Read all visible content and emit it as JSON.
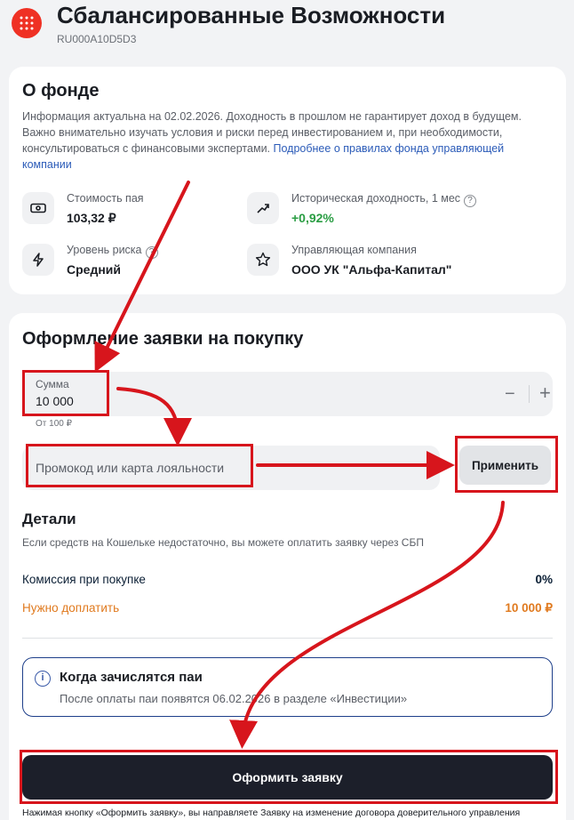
{
  "header": {
    "title": "Сбалансированные Возможности",
    "code": "RU000A10D5D3",
    "brand_color": "#ef3124"
  },
  "about": {
    "heading": "О фонде",
    "disclaimer": "Информация актуальна на 02.02.2026. Доходность в прошлом не гарантирует доход в будущем. Важно внимательно изучать условия и риски перед инвестированием и, при необходимости, консультироваться с финансовыми экспертами.",
    "link_text": "Подробнее о правилах фонда управляющей компании",
    "stats": [
      {
        "icon": "banknote-icon",
        "label": "Стоимость пая",
        "value": "103,32 ₽"
      },
      {
        "icon": "chart-up-icon",
        "label": "Историческая доходность, 1 мес",
        "value": "+0,92%",
        "value_color": "#2a9d43"
      },
      {
        "icon": "lightning-icon",
        "label": "Уровень риска",
        "value": "Средний"
      },
      {
        "icon": "star-icon",
        "label": "Управляющая компания",
        "value": "ООО УК \"Альфа-Капитал\""
      }
    ]
  },
  "order": {
    "heading": "Оформление заявки на покупку",
    "amount": {
      "label": "Сумма",
      "value": "10 000",
      "hint": "От 100 ₽",
      "minus": "−",
      "plus": "+"
    },
    "promo": {
      "placeholder": "Промокод или карта лояльности",
      "button": "Применить"
    },
    "details": {
      "heading": "Детали",
      "note": "Если средств на Кошельке недостаточно, вы можете оплатить заявку через СБП",
      "commission_label": "Комиссия при покупке",
      "commission_value": "0%",
      "topup_label": "Нужно доплатить",
      "topup_value": "10 000 ₽",
      "accent_color": "#e07a1f"
    },
    "info": {
      "icon_glyph": "i",
      "title": "Когда зачислятся паи",
      "text": "После оплаты паи появятся 06.02.2026 в разделе «Инвестиции»"
    },
    "submit": "Оформить заявку",
    "footnote": "Нажимая кнопку «Оформить заявку», вы направляете Заявку на изменение договора доверительного управления"
  },
  "annotation_color": "#d7151c"
}
